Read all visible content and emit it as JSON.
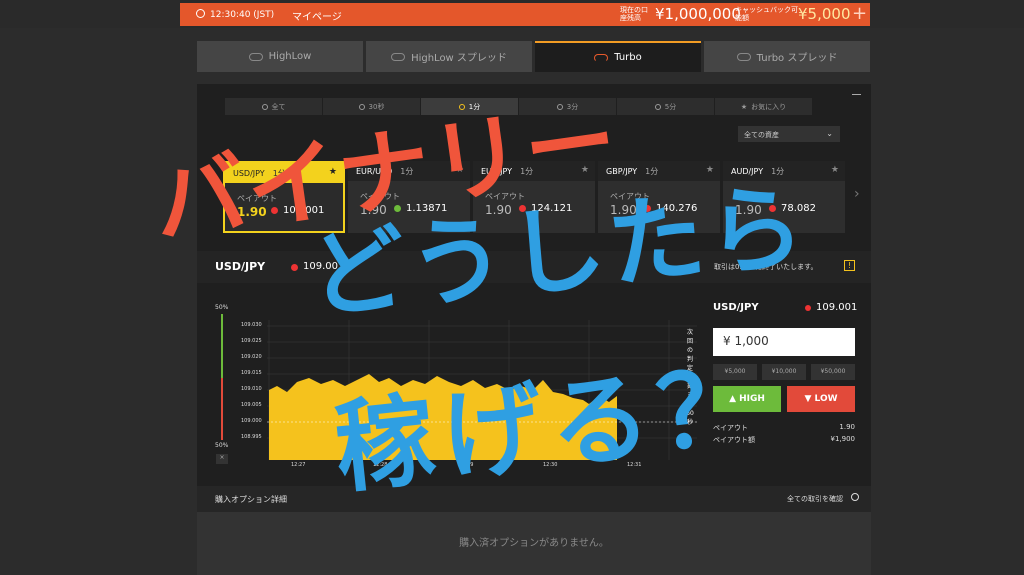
{
  "topbar": {
    "time": "12:30:40 (JST)",
    "mypage": "マイページ",
    "balance_label": "現在の口座残高",
    "balance": "¥1,000,000",
    "cashback_label": "キャッシュバック可能額",
    "cashback": "¥5,000",
    "plus": "+"
  },
  "tabs": [
    {
      "label": "HighLow"
    },
    {
      "label": "HighLow スプレッド"
    },
    {
      "label": "Turbo"
    },
    {
      "label": "Turbo スプレッド"
    }
  ],
  "periods": [
    {
      "label": "全て"
    },
    {
      "label": "30秒"
    },
    {
      "label": "1分"
    },
    {
      "label": "3分"
    },
    {
      "label": "5分"
    },
    {
      "label": "お気に入り"
    }
  ],
  "asset_filter": "全ての資産",
  "cards": [
    {
      "pair": "USD/JPY",
      "period": "1分",
      "payout_label": "ペイアウト",
      "payout": "1.90",
      "price": "109.001",
      "dir": "down"
    },
    {
      "pair": "EUR/USD",
      "period": "1分",
      "payout_label": "ペイアウト",
      "payout": "1.90",
      "price": "1.13871",
      "dir": "up"
    },
    {
      "pair": "EUR/JPY",
      "period": "1分",
      "payout_label": "ペイアウト",
      "payout": "1.90",
      "price": "124.121",
      "dir": "down"
    },
    {
      "pair": "GBP/JPY",
      "period": "1分",
      "payout_label": "ペイアウト",
      "payout": "1.90",
      "price": "140.276",
      "dir": "down"
    },
    {
      "pair": "AUD/JPY",
      "period": "1分",
      "payout_label": "ペイアウト",
      "payout": "1.90",
      "price": "78.082",
      "dir": "down"
    }
  ],
  "selected_asset": {
    "name": "USD/JPY",
    "price": "109.001",
    "note": "取引は05:00に終了いたします。"
  },
  "chart": {
    "meter_top": "50%",
    "meter_bottom": "50%",
    "y_ticks": [
      "109.030",
      "109.025",
      "109.020",
      "109.015",
      "109.010",
      "109.005",
      "109.000",
      "108.995"
    ],
    "x_ticks": [
      "12:27",
      "12:28",
      "12:29",
      "12:30",
      "12:31"
    ],
    "next_label": "次回の判定時刻まで60秒",
    "close": "×",
    "fill_color": "#f5c21d"
  },
  "trade": {
    "name": "USD/JPY",
    "price": "109.001",
    "amount": "¥ 1,000",
    "quick": [
      "¥5,000",
      "¥10,000",
      "¥50,000"
    ],
    "high": "HIGH",
    "low": "LOW",
    "payout_label": "ペイアウト",
    "payout": "1.90",
    "payout_amount_label": "ペイアウト額",
    "payout_amount": "¥1,900"
  },
  "purchase": {
    "title": "購入オプション詳細",
    "all_link": "全ての取引を確認",
    "empty": "購入済オプションがありません。"
  },
  "overlay": {
    "line1": "バイナリー",
    "line2": "どうしたら",
    "line3": "稼げる？"
  },
  "colors": {
    "accent": "#e4572b",
    "gold": "#f3d21d",
    "high": "#6dbb3b",
    "low": "#e24a3a",
    "overlay_red": "#f0553b",
    "overlay_blue": "#2f9fe2"
  }
}
